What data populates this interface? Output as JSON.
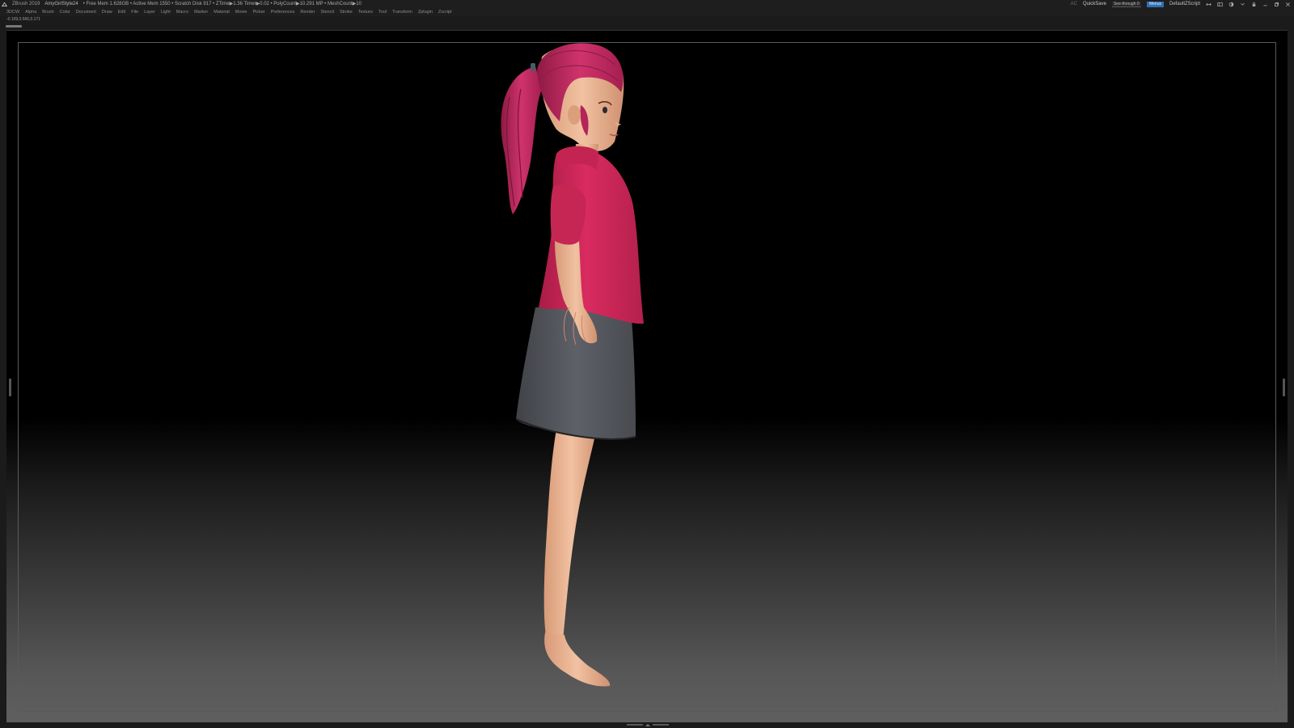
{
  "titlebar": {
    "app_name": "ZBrush 2019",
    "document": "AmyGirlStyle24",
    "stats": "• Free Mem 1.628GB • Active Mem 1550 • Scratch Disk 917 • ZTime▶1.36 Timer▶0.02 • PolyCount▶10.291 MP • MeshCount▶10",
    "ac_label": "AC",
    "quicksave_label": "QuickSave",
    "seethrough_label": "See-through   0",
    "seethrough_value": 0,
    "menus_label": "Menus",
    "script_label": "DefaultZScript"
  },
  "menubar": {
    "items": [
      "3DCW",
      "Alpha",
      "Brush",
      "Color",
      "Document",
      "Draw",
      "Edit",
      "File",
      "Layer",
      "Light",
      "Macro",
      "Marker",
      "Material",
      "Movie",
      "Picker",
      "Preferences",
      "Render",
      "Stencil",
      "Stroke",
      "Texture",
      "Tool",
      "Transform",
      "Zplugin",
      "Zscript"
    ]
  },
  "coords": "-0.109,0.566,0.171",
  "colors": {
    "shirt": "#d4285a",
    "hair": "#c2245f",
    "skin": "#e9b594",
    "skirt": "#4f5258",
    "canvas_top": "#000000",
    "canvas_bottom": "#5f5f5f",
    "accent": "#2f6fb8"
  }
}
